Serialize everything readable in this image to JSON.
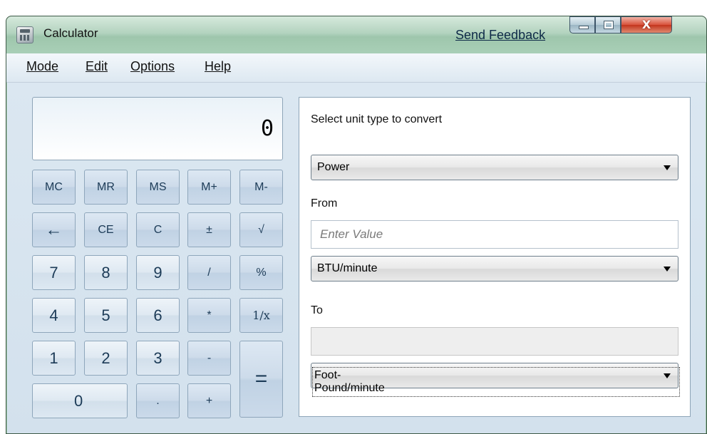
{
  "window": {
    "title": "Calculator",
    "feedback_link": "Send Feedback",
    "controls": {
      "minimize": "minimize",
      "maximize": "maximize",
      "close": "X"
    }
  },
  "menu": {
    "items": [
      "Mode",
      "Edit",
      "Options",
      "Help"
    ]
  },
  "display": {
    "value": "0"
  },
  "keypad": {
    "memory": [
      "MC",
      "MR",
      "MS",
      "M+",
      "M-"
    ],
    "row2": [
      "←",
      "CE",
      "C",
      "±",
      "√"
    ],
    "row3": [
      "7",
      "8",
      "9",
      "/",
      "%"
    ],
    "row4": [
      "4",
      "5",
      "6",
      "*",
      "1/x"
    ],
    "row5": [
      "1",
      "2",
      "3",
      "-"
    ],
    "row6": [
      "0",
      ".",
      "+"
    ],
    "equals": "="
  },
  "converter": {
    "heading": "Select unit type to convert",
    "unit_type": "Power",
    "from_label": "From",
    "from_placeholder": "Enter Value",
    "from_unit": "BTU/minute",
    "to_label": "To",
    "to_value": "",
    "to_unit": "Foot-Pound/minute"
  }
}
